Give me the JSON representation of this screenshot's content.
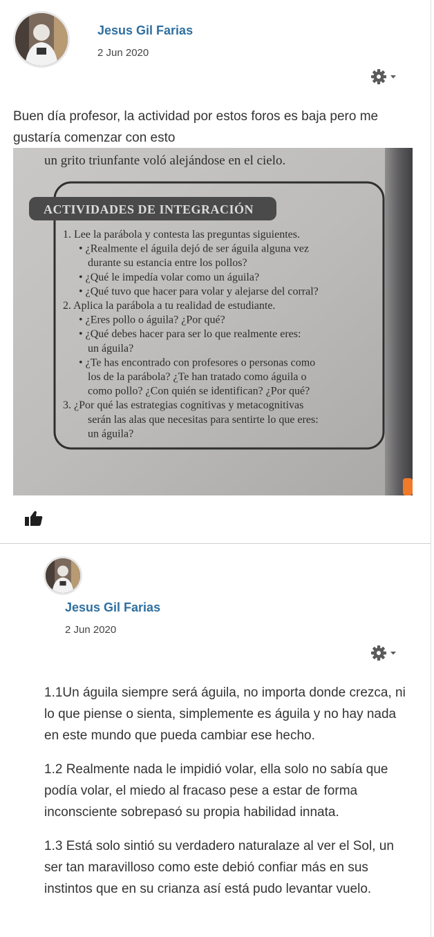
{
  "post": {
    "author": "Jesus Gil Farias",
    "date": "2 Jun 2020",
    "message": "Buen día profesor, la actividad por estos foros es baja pero me gustaría comenzar con esto",
    "image": {
      "top_line": "un grito triunfante voló alejándose en el cielo.",
      "heading": "ACTIVIDADES DE INTEGRACIÓN",
      "lines": [
        "1.  Lee la parábola y contesta las preguntas siguientes.",
        "•  ¿Realmente el águila dejó de ser águila alguna vez",
        "durante su estancia entre los pollos?",
        "•  ¿Qué le impedía volar como un águila?",
        "•  ¿Qué tuvo que hacer para volar y alejarse del corral?",
        "2.  Aplica la parábola a tu realidad de estudiante.",
        "•  ¿Eres pollo o águila? ¿Por qué?",
        "•  ¿Qué debes hacer para ser lo que realmente eres:",
        "un águila?",
        "•  ¿Te has encontrado con profesores o personas como",
        "los de la parábola? ¿Te han tratado como águila o",
        "como pollo? ¿Con quién se identifican? ¿Por qué?",
        "3.  ¿Por qué las estrategias cognitivas y metacognitivas",
        "serán las alas que necesitas para sentirte lo que eres:",
        "un águila?"
      ]
    }
  },
  "reply": {
    "author": "Jesus Gil Farias",
    "date": "2 Jun 2020",
    "paragraphs": [
      "1.1Un águila siempre será águila, no importa donde crezca, ni lo que piense o sienta, simplemente es águila y no hay nada en este mundo que pueda cambiar ese hecho.",
      "1.2 Realmente nada le impidió volar, ella solo no sabía que podía volar, el miedo al fracaso pese a estar de forma inconsciente sobrepasó su propia habilidad innata.",
      "1.3 Está solo sintió su verdadero naturalaze al ver el Sol, un ser tan maravilloso como este debió confiar más en sus instintos que en su crianza así está pudo levantar vuelo."
    ]
  },
  "icons": {
    "gear": "gear-icon",
    "caret": "caret-down-icon",
    "like": "thumbs-up-icon"
  },
  "colors": {
    "author_link": "#2f6fa0",
    "accent_orange": "#f07a2a"
  }
}
